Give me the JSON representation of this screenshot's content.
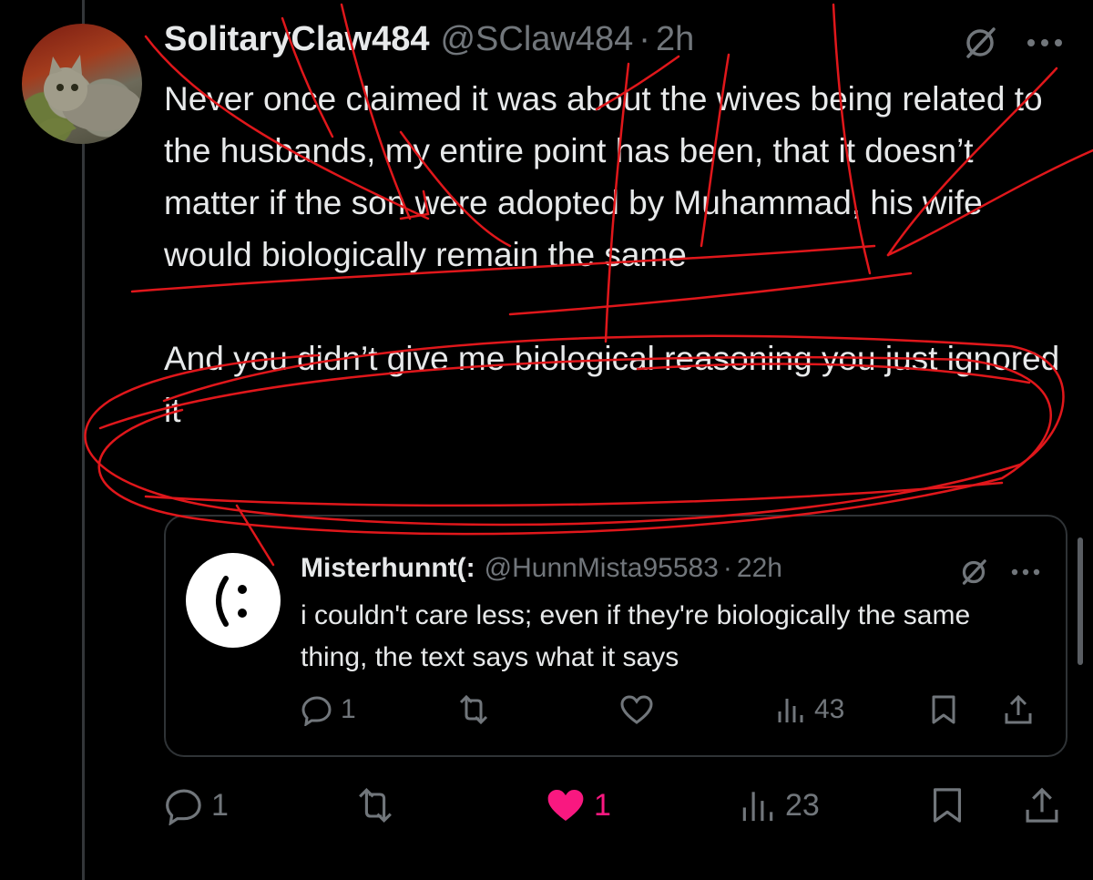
{
  "post": {
    "author_name": "SolitaryClaw484",
    "handle": "@SClaw484",
    "separator": "·",
    "time": "2h",
    "paragraph1": "Never once claimed it was about the wives being related to the husbands, my entire point has been, that it doesn’t matter if the son were adopted by Muhammad, his wife would biologically remain the same",
    "paragraph2": "And you didn’t give me biological reasoning you just ignored it",
    "icons": [
      "grok-icon",
      "more-icon"
    ],
    "actions": {
      "reply_count": "1",
      "like_count": "1",
      "views_count": "23"
    },
    "like_color": "#f91880"
  },
  "quote": {
    "author_name": "Misterhunnt(:",
    "handle": "@HunnMista95583",
    "separator": "·",
    "time": "22h",
    "text": "i couldn't care less; even if they're biologically the same thing, the text says what it says",
    "actions": {
      "reply_count": "1",
      "views_count": "43"
    }
  },
  "colors": {
    "background": "#000000",
    "text": "#e7e9ea",
    "muted": "#71767b",
    "annotation": "#e0171b"
  }
}
